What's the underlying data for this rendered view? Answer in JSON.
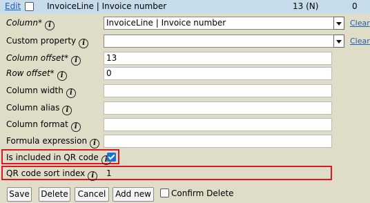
{
  "header": {
    "edit_label": "Edit",
    "title": "InvoiceLine | Invoice number",
    "column_info": "13 (N)",
    "row_info": "0"
  },
  "fields": {
    "column": {
      "label": "Column*",
      "value": "InvoiceLine | Invoice number",
      "clear": "Clear"
    },
    "custom_property": {
      "label": "Custom property",
      "value": "",
      "clear": "Clear"
    },
    "column_offset": {
      "label": "Column offset*",
      "value": "13"
    },
    "row_offset": {
      "label": "Row offset*",
      "value": "0"
    },
    "column_width": {
      "label": "Column width",
      "value": ""
    },
    "column_alias": {
      "label": "Column alias",
      "value": ""
    },
    "column_format": {
      "label": "Column format",
      "value": ""
    },
    "formula_expression": {
      "label": "Formula expression",
      "value": ""
    },
    "qr_included": {
      "label": "Is included in QR code",
      "checked": true
    },
    "qr_sort_index": {
      "label": "QR code sort index",
      "value": "1"
    }
  },
  "info_glyph": "i",
  "buttons": {
    "save": "Save",
    "delete": "Delete",
    "cancel": "Cancel",
    "add_new": "Add new"
  },
  "confirm_delete": {
    "label": "Confirm Delete",
    "checked": false
  },
  "colors": {
    "background": "#dfdcc8",
    "header": "#c6dcea",
    "highlight_border": "#e0141e",
    "checkbox_accent": "#1d6fd6",
    "link": "#1a5fb4"
  },
  "icons": [
    "info-icon",
    "dropdown-arrow-icon",
    "checkbox-checked-icon"
  ]
}
